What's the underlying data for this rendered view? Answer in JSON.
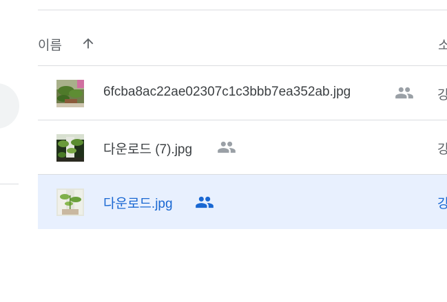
{
  "list_header": {
    "name_column": "이름",
    "owner_column": "소"
  },
  "files": [
    {
      "name": "6fcba8ac22ae02307c1c3bbb7ea352ab.jpg",
      "shared": true,
      "owner": "강",
      "selected": false
    },
    {
      "name": "다운로드 (7).jpg",
      "shared": true,
      "owner": "강",
      "selected": false
    },
    {
      "name": "다운로드.jpg",
      "shared": true,
      "owner": "강",
      "selected": true
    }
  ],
  "icons": {
    "sort": "arrow-up-icon",
    "shared": "people-icon"
  },
  "colors": {
    "selected_row_bg": "#e8f0fe",
    "selected_text": "#1967d2",
    "shared_icon": "#9aa0a6",
    "divider": "#dadce0"
  }
}
